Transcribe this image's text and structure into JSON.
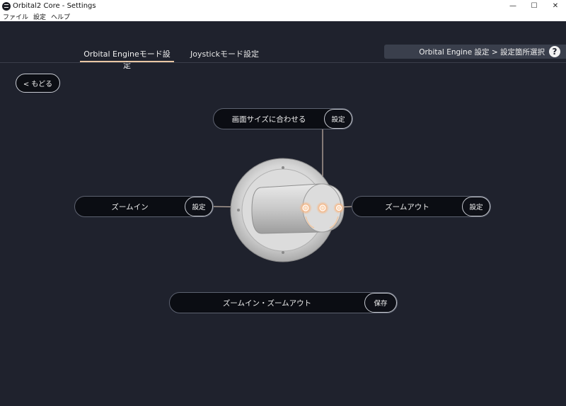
{
  "window": {
    "title": "Orbital2 Core - Settings",
    "minimize": "—",
    "maximize": "☐",
    "close": "✕"
  },
  "menu": [
    "ファイル",
    "設定",
    "ヘルプ"
  ],
  "tabs": [
    {
      "label": "Orbital Engineモード設定",
      "active": true
    },
    {
      "label": "Joystickモード設定",
      "active": false
    }
  ],
  "breadcrumb": {
    "text": "Orbital Engine 設定 > 設定箇所選択",
    "help": "?"
  },
  "back_label": "< もどる",
  "controls": {
    "fit_screen": {
      "label": "画面サイズに合わせる",
      "button": "設定"
    },
    "zoom_in": {
      "label": "ズームイン",
      "button": "設定"
    },
    "zoom_out": {
      "label": "ズームアウト",
      "button": "設定"
    },
    "zoom_combo": {
      "label": "ズームイン・ズームアウト",
      "button": "保存"
    }
  },
  "colors": {
    "accent": "#e9c7a4",
    "highlight_glow": "#f5b98a",
    "background": "#1f222d"
  }
}
